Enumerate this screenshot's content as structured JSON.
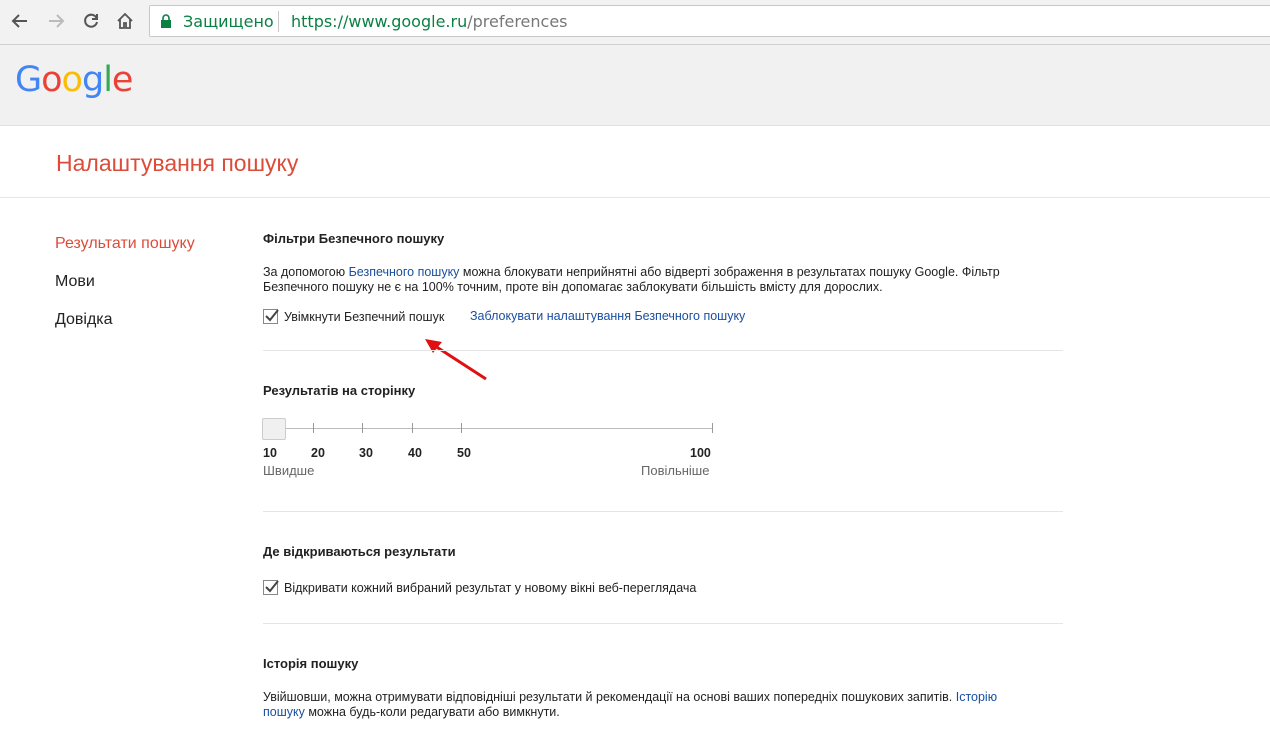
{
  "browser": {
    "secure_label": "Защищено",
    "url_host": "https://www.google.ru",
    "url_path": "/preferences"
  },
  "header": {
    "logo_letters": [
      "G",
      "o",
      "o",
      "g",
      "l",
      "e"
    ],
    "logo_colors": [
      "#4285F4",
      "#EA4335",
      "#FBBC05",
      "#4285F4",
      "#34A853",
      "#EA4335"
    ]
  },
  "page": {
    "title": "Налаштування пошуку"
  },
  "sidebar": {
    "items": [
      {
        "label": "Результати пошуку",
        "active": true
      },
      {
        "label": "Мови",
        "active": false
      },
      {
        "label": "Довідка",
        "active": false
      }
    ]
  },
  "safe_search": {
    "heading": "Фільтри Безпечного пошуку",
    "text_before_link": "За допомогою ",
    "link_text": "Безпечного пошуку",
    "text_after_link": " можна блокувати неприйнятні або відверті зображення в результатах пошуку Google. Фільтр Безпечного пошуку не є на 100% точним, проте він допомагає заблокувати більшість вмісту для дорослих.",
    "checkbox_label": "Увімкнути Безпечний пошук",
    "checkbox_checked": true,
    "lock_link": "Заблокувати налаштування Безпечного пошуку"
  },
  "results_per_page": {
    "heading": "Результатів на сторінку",
    "ticks": [
      "10",
      "20",
      "30",
      "40",
      "50",
      "100"
    ],
    "selected": "10",
    "faster_label": "Швидше",
    "slower_label": "Повільніше"
  },
  "open_results": {
    "heading": "Де відкриваються результати",
    "checkbox_label": "Відкривати кожний вибраний результат у новому вікні веб-переглядача",
    "checkbox_checked": true
  },
  "history": {
    "heading": "Історія пошуку",
    "text_before_link": "Увійшовши, можна отримувати відповідніші результати й рекомендації на основі ваших попередніх пошукових запитів. ",
    "link_text": "Історію пошуку",
    "text_after_link": " можна будь-коли редагувати або вимкнути."
  },
  "colors": {
    "accent_red": "#dd4b39",
    "link_blue": "#1a4fa0",
    "secure_green": "#0b8043"
  }
}
